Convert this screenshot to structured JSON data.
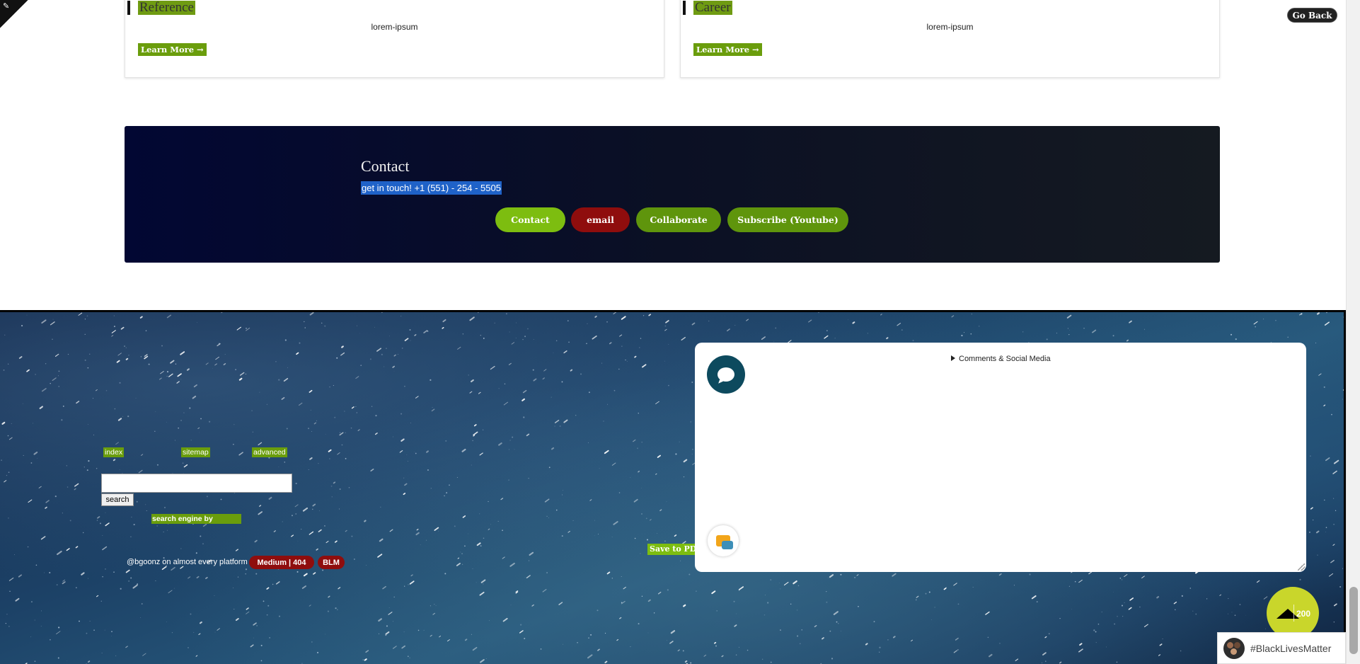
{
  "header": {
    "go_back_label": "Go Back"
  },
  "cards": [
    {
      "title": "Reference",
      "body": "lorem-ipsum",
      "link_label": "Learn More →"
    },
    {
      "title": "Career",
      "body": "lorem-ipsum",
      "link_label": "Learn More →"
    }
  ],
  "contact": {
    "title": "Contact",
    "subtitle": "get in touch! +1 (551) - 254 - 5505",
    "buttons": [
      {
        "label": "Contact",
        "color": "#7dbd10"
      },
      {
        "label": "email",
        "color": "#8f0d0d"
      },
      {
        "label": "Collaborate",
        "color": "#5f950c"
      },
      {
        "label": "Subscribe (Youtube)",
        "color": "#5f950c"
      }
    ]
  },
  "footer": {
    "nav_links": [
      "index",
      "sitemap",
      "advanced"
    ],
    "search": {
      "value": "",
      "placeholder": "",
      "button_label": "search"
    },
    "engine_label": "search engine by",
    "platform_text": "@bgoonz on almost every platform",
    "pills": [
      "Medium | 404",
      "BLM"
    ],
    "pdf_label": "Save to PDF",
    "comments_summary": "Comments & Social Media",
    "top_count": "200",
    "blm_badge": "#BlackLivesMatter"
  },
  "icons": {
    "chat": "chat-bubble-icon",
    "messages": "message-bubbles-icon",
    "up": "arrow-up-icon",
    "corner": "corner-ribbon-icon",
    "blm_logo": "blm-logo-icon"
  },
  "colors": {
    "accent_green": "#6a9d0c",
    "accent_red": "#8f0d0d",
    "contact_bg_start": "#020733",
    "contact_bg_end": "#151a21",
    "top_button": "#c9d62b"
  }
}
